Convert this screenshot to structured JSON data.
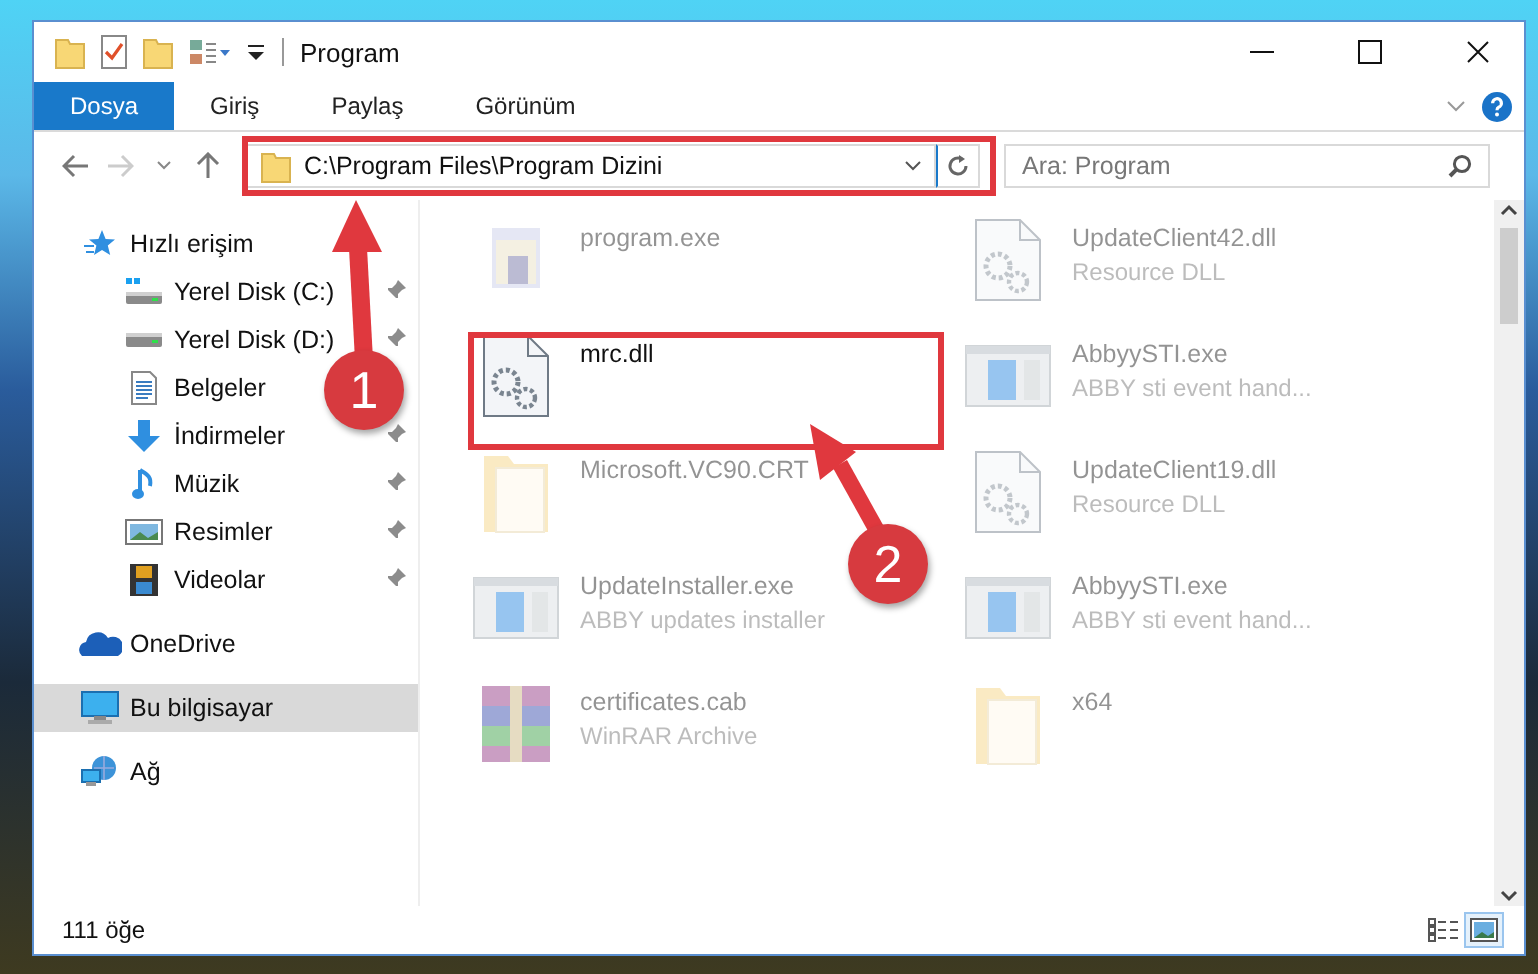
{
  "window": {
    "title": "Program"
  },
  "ribbon_tabs": [
    {
      "label": "Dosya",
      "selected": true
    },
    {
      "label": "Giriş",
      "selected": false
    },
    {
      "label": "Paylaş",
      "selected": false
    },
    {
      "label": "Görünüm",
      "selected": false
    }
  ],
  "address_bar": {
    "path": "C:\\Program Files\\Program Dizini"
  },
  "search": {
    "placeholder": "Ara: Program"
  },
  "sidebar": {
    "items": [
      {
        "label": "Hızlı erişim",
        "kind": "star",
        "selected": false,
        "children": [
          {
            "label": "Yerel Disk (C:)",
            "kind": "system-drive",
            "pinned": true,
            "selected": false
          },
          {
            "label": "Yerel Disk (D:)",
            "kind": "drive",
            "pinned": true,
            "selected": false
          },
          {
            "label": "Belgeler",
            "kind": "documents",
            "pinned": false,
            "selected": false
          },
          {
            "label": "İndirmeler",
            "kind": "downloads",
            "pinned": true,
            "selected": false
          },
          {
            "label": "Müzik",
            "kind": "music",
            "pinned": true,
            "selected": false
          },
          {
            "label": "Resimler",
            "kind": "pictures",
            "pinned": true,
            "selected": false
          },
          {
            "label": "Videolar",
            "kind": "videos",
            "pinned": true,
            "selected": false
          }
        ]
      },
      {
        "label": "OneDrive",
        "kind": "cloud",
        "selected": false
      },
      {
        "label": "Bu bilgisayar",
        "kind": "computer",
        "selected": true
      },
      {
        "label": "Ağ",
        "kind": "network",
        "selected": false
      }
    ]
  },
  "files": [
    {
      "name": "program.exe",
      "kind": "program",
      "blurred": true
    },
    {
      "name": "UpdateClient42.dll",
      "detail": "Resource DLL",
      "kind": "dll",
      "blurred": true
    },
    {
      "name": "mrc.dll",
      "kind": "dll",
      "blurred": false
    },
    {
      "name": "AbbyySTI.exe",
      "detail": "ABBY sti event hand...",
      "kind": "app",
      "blurred": true
    },
    {
      "name": "Microsoft.VC90.CRT",
      "kind": "folder",
      "blurred": true
    },
    {
      "name": "UpdateClient19.dll",
      "detail": "Resource DLL",
      "kind": "dll",
      "blurred": true
    },
    {
      "name": "UpdateInstaller.exe",
      "detail": "ABBY updates installer",
      "kind": "app",
      "blurred": true
    },
    {
      "name": "AbbyySTI.exe",
      "detail": "ABBY sti event hand...",
      "kind": "app",
      "blurred": true
    },
    {
      "name": "certificates.cab",
      "detail": "WinRAR Archive",
      "kind": "archive",
      "blurred": true
    },
    {
      "name": "x64",
      "kind": "folder",
      "blurred": true
    }
  ],
  "status_bar": {
    "item_count": "111 öğe",
    "views": [
      {
        "selected": false
      },
      {
        "selected": true
      }
    ]
  },
  "annotations": [
    {
      "label": "1"
    },
    {
      "label": "2"
    }
  ]
}
